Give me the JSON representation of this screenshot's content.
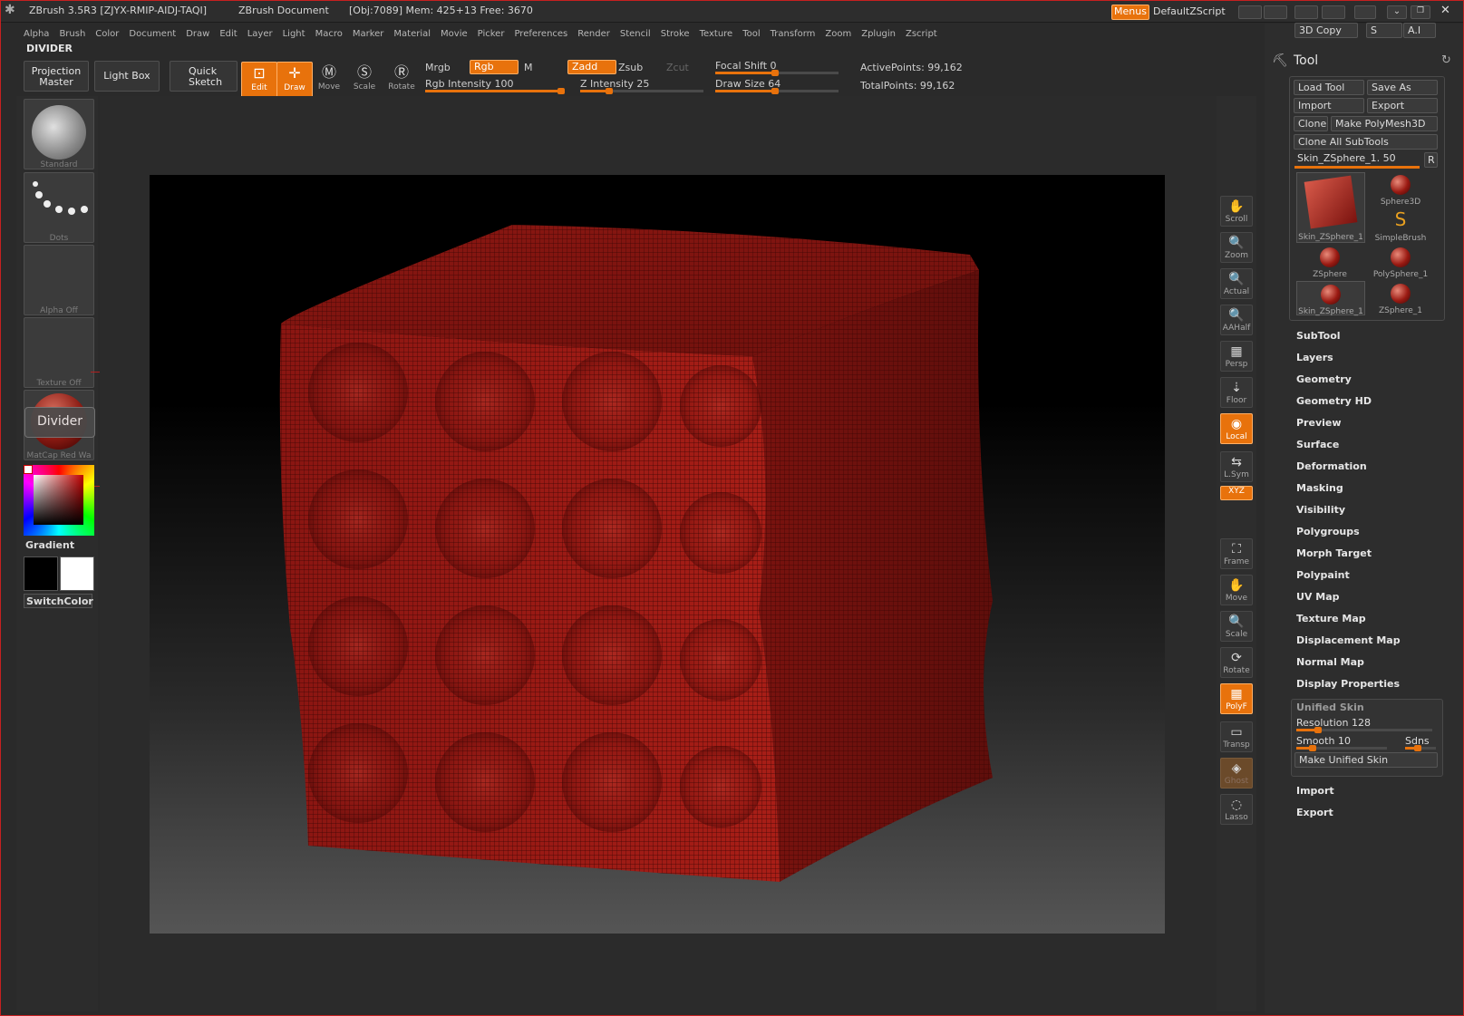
{
  "titlebar": {
    "app_title": "ZBrush 3.5R3 [ZJYX-RMIP-AIDJ-TAQI]",
    "document": "ZBrush Document",
    "stats": "[Obj:7089] Mem: 425+13 Free: 3670",
    "menus_label": "Menus",
    "script_label": "DefaultZScript"
  },
  "menubar": [
    "Alpha",
    "Brush",
    "Color",
    "Document",
    "Draw",
    "Edit",
    "Layer",
    "Light",
    "Macro",
    "Marker",
    "Material",
    "Movie",
    "Picker",
    "Preferences",
    "Render",
    "Stencil",
    "Stroke",
    "Texture",
    "Tool",
    "Transform",
    "Zoom",
    "Zplugin",
    "Zscript"
  ],
  "tool_title": "DIVIDER",
  "toolbar": {
    "projection_master": "Projection Master",
    "light_box": "Light Box",
    "quick_sketch": "Quick Sketch",
    "edit": "Edit",
    "draw": "Draw",
    "move": "Move",
    "scale": "Scale",
    "rotate": "Rotate",
    "mrgb": "Mrgb",
    "rgb": "Rgb",
    "m": "M",
    "zadd": "Zadd",
    "zsub": "Zsub",
    "zcut": "Zcut",
    "rgb_intensity": "Rgb Intensity 100",
    "z_intensity": "Z Intensity 25",
    "focal_shift": "Focal Shift 0",
    "draw_size": "Draw Size 64",
    "active_points": "ActivePoints: 99,162",
    "total_points": "TotalPoints: 99,162"
  },
  "slider_levels": {
    "rgb_intensity": 1.0,
    "z_intensity": 0.25,
    "focal_shift": 0.5,
    "draw_size": 0.5
  },
  "left_shelf": {
    "brush": "Standard",
    "stroke": "Dots",
    "alpha": "Alpha  Off",
    "texture": "Texture  Off",
    "material": "MatCap Red Wa",
    "tooltip": "Divider",
    "gradient": "Gradient",
    "switch_color": "SwitchColor"
  },
  "right_shelf": [
    "Scroll",
    "Zoom",
    "Actual",
    "AAHalf",
    "Persp",
    "Floor",
    "Local",
    "L.Sym",
    "XYZ",
    "Frame",
    "Move",
    "Scale",
    "Rotate",
    "PolyF",
    "Transp",
    "Ghost",
    "Lasso"
  ],
  "tool_palette": {
    "copy3d": "3D Copy",
    "s_label": "S",
    "ai_label": "A.I",
    "title": "Tool",
    "load_tool": "Load Tool",
    "save_as": "Save As",
    "import": "Import",
    "export": "Export",
    "clone": "Clone",
    "make_polymesh": "Make PolyMesh3D",
    "clone_all": "Clone All SubTools",
    "current_tool": "Skin_ZSphere_1. 50",
    "r_label": "R",
    "tools": [
      {
        "name": "Skin_ZSphere_1"
      },
      {
        "name": "Sphere3D"
      },
      {
        "name": "SimpleBrush"
      },
      {
        "name": "ZSphere"
      },
      {
        "name": "PolySphere_1"
      },
      {
        "name": "Skin_ZSphere_1"
      },
      {
        "name": "ZSphere_1"
      }
    ],
    "sections": [
      "SubTool",
      "Layers",
      "Geometry",
      "Geometry HD",
      "Preview",
      "Surface",
      "Deformation",
      "Masking",
      "Visibility",
      "Polygroups",
      "Morph Target",
      "Polypaint",
      "UV Map",
      "Texture Map",
      "Displacement Map",
      "Normal Map",
      "Display Properties"
    ],
    "unified_skin": {
      "title": "Unified Skin",
      "resolution": "Resolution 128",
      "smooth": "Smooth 10",
      "sdns": "Sdns",
      "make": "Make Unified Skin"
    },
    "bottom": [
      "Import",
      "Export"
    ]
  },
  "colors": {
    "accent": "#e8720c",
    "model": "#8a1a14",
    "background": "#2a2a2a"
  }
}
